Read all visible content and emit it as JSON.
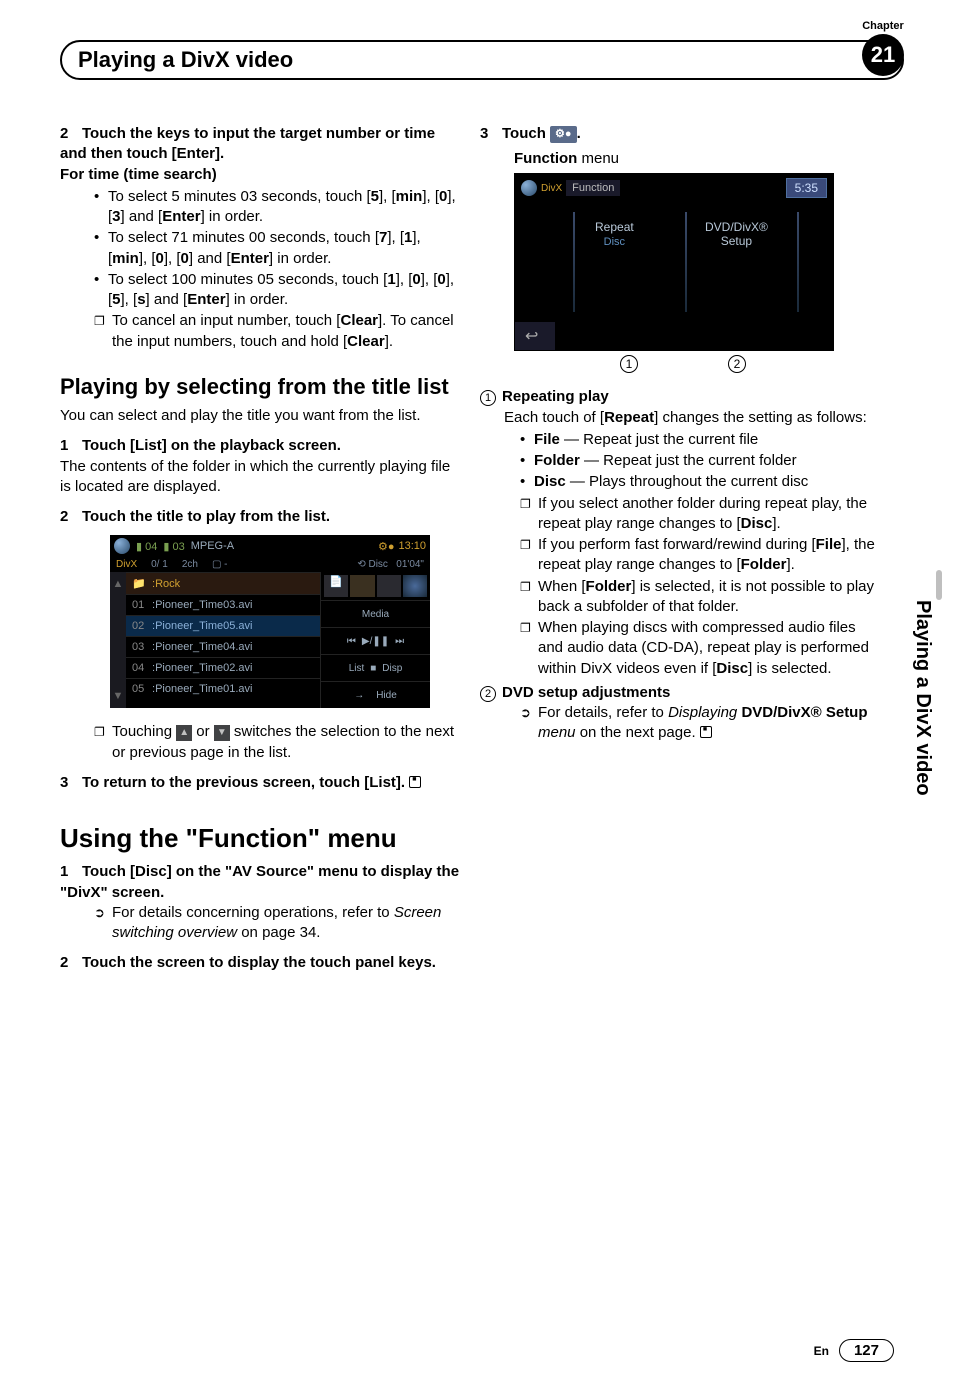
{
  "header": {
    "title": "Playing a DivX video",
    "chapter_label": "Chapter",
    "chapter_number": "21"
  },
  "side_label": "Playing a DivX video",
  "footer": {
    "lang": "En",
    "page": "127"
  },
  "left": {
    "step2_a": "2",
    "step2_text": "Touch the keys to input the target number or time and then touch [Enter].",
    "step2_sub": "For time (time search)",
    "bullets": {
      "b1a": "To select 5 minutes 03 seconds, touch [",
      "b1b": "], [",
      "b1c": "], [",
      "b1d": "], [",
      "b1e": "] and [",
      "b1f": "] in order.",
      "b1_5": "5",
      "b1_min": "min",
      "b1_0": "0",
      "b1_3": "3",
      "b1_enter": "Enter",
      "b2a": "To select 71 minutes 00 seconds, touch [",
      "b2_7": "7",
      "b2_1": "1",
      "b2_min": "min",
      "b2_0a": "0",
      "b2_0b": "0",
      "b2_enter": "Enter",
      "b3a": "To select 100 minutes 05 seconds, touch [",
      "b3_1": "1",
      "b3_0a": "0",
      "b3_0b": "0",
      "b3_5": "5",
      "b3_s": "s",
      "b3_enter": "Enter"
    },
    "note1a": "To cancel an input number, touch [",
    "note1_clear": "Clear",
    "note1b": "]. To cancel the input numbers, touch and hold [",
    "note1c": "].",
    "section_title_list": "Playing by selecting from the title list",
    "list_intro": "You can select and play the title you want from the list.",
    "list_step1_n": "1",
    "list_step1": "Touch [List] on the playback screen.",
    "list_step1_body": "The contents of the folder in which the currently playing file is located are displayed.",
    "list_step2_n": "2",
    "list_step2": "Touch the title to play from the list.",
    "list_note": "Touching ",
    "list_note2": " or ",
    "list_note3": " switches the selection to the next or previous page in the list.",
    "list_step3_n": "3",
    "list_step3": "To return to the previous screen, touch [List].",
    "section_func": "Using the \"",
    "section_func_mid": "Function",
    "section_func_end": "\" menu",
    "func_step1_n": "1",
    "func_step1a": "Touch [Disc] on the \"AV Source\" menu to display the \"DivX\" screen.",
    "func_step1_ref": "For details concerning operations, refer to ",
    "func_step1_ref_it": "Screen switching overview",
    "func_step1_ref_end": " on page 34.",
    "func_step2_n": "2",
    "func_step2": "Touch the screen to display the touch panel keys.",
    "list_shot": {
      "top": {
        "seg04": "04",
        "seg03": "03",
        "codec": "MPEG-A",
        "clock": "13:10"
      },
      "sub": {
        "divx": "0/ 1",
        "ch": "2ch",
        "box": "▢ -",
        "disc": "⟲ Disc",
        "time": "01'04\""
      },
      "folder": "Rock",
      "rows": [
        {
          "n": "01",
          "t": "Pioneer_Time03.avi"
        },
        {
          "n": "02",
          "t": "Pioneer_Time05.avi"
        },
        {
          "n": "03",
          "t": "Pioneer_Time04.avi"
        },
        {
          "n": "04",
          "t": "Pioneer_Time02.avi"
        },
        {
          "n": "05",
          "t": "Pioneer_Time01.avi"
        }
      ],
      "right": {
        "media": "Media",
        "list": "List",
        "stop": "■",
        "disp": "Disp",
        "arrow": "→",
        "hide": "Hide",
        "prev": "⏮",
        "play": "▶/❚❚",
        "next": "⏭",
        "folder": "📄"
      }
    }
  },
  "right": {
    "step3_n": "3",
    "step3_a": "Touch ",
    "step3_icon": "⚙●",
    "step3_b": ".",
    "func_caption_a": "Function",
    "func_caption_b": " menu",
    "func_shot": {
      "label": "Function",
      "time": "5:35",
      "repeat": "Repeat",
      "disc": "Disc",
      "setup_a": "DVD/DivX®",
      "setup_b": "Setup",
      "back": "↩",
      "m1": "1",
      "m2": "2"
    },
    "item1_n": "1",
    "item1_title": "Repeating play",
    "item1_intro_a": "Each touch of [",
    "item1_intro_b": "Repeat",
    "item1_intro_c": "] changes the setting as follows:",
    "rb_file": "File",
    "rb_file_t": " — Repeat just the current file",
    "rb_folder": "Folder",
    "rb_folder_t": " — Repeat just the current folder",
    "rb_disc": "Disc",
    "rb_disc_t": " — Plays throughout the current disc",
    "rn1_a": "If you select another folder during repeat play, the repeat play range changes to [",
    "rn1_b": "Disc",
    "rn1_c": "].",
    "rn2_a": "If you perform fast forward/rewind during [",
    "rn2_b": "File",
    "rn2_c": "], the repeat play range changes to [",
    "rn2_d": "Folder",
    "rn2_e": "].",
    "rn3_a": "When [",
    "rn3_b": "Folder",
    "rn3_c": "] is selected, it is not possible to play back a subfolder of that folder.",
    "rn4_a": "When playing discs with compressed audio files and audio data (CD-DA), repeat play is performed within DivX videos even if [",
    "rn4_b": "Disc",
    "rn4_c": "] is selected.",
    "item2_n": "2",
    "item2_title": "DVD setup adjustments",
    "item2_ref_a": "For details, refer to ",
    "item2_ref_it": "Displaying ",
    "item2_ref_b": "DVD/DivX® Setup",
    "item2_ref_it2": " menu",
    "item2_ref_end": " on the next page."
  }
}
